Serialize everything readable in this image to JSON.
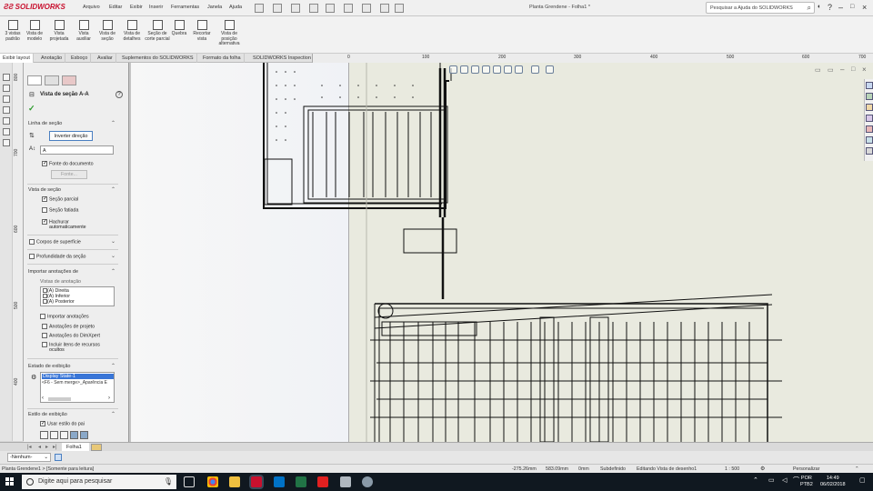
{
  "app": {
    "brand": "SOLIDWORKS",
    "doc_title": "Planta Grendene - Folha1 *",
    "menu": [
      "Arquivo",
      "Editar",
      "Exibir",
      "Inserir",
      "Ferramentas",
      "Janela",
      "Ajuda"
    ],
    "help_search_placeholder": "Pesquisar a Ajuda do SOLIDWORKS"
  },
  "ribbon": {
    "buttons": [
      {
        "label": "3 vistas padrão"
      },
      {
        "label": "Vista de modelo"
      },
      {
        "label": "Vista projetada"
      },
      {
        "label": "Vista auxiliar"
      },
      {
        "label": "Vista de seção"
      },
      {
        "label": "Vista de detalhes"
      },
      {
        "label": "Seção de corte parcial"
      },
      {
        "label": "Quebra"
      },
      {
        "label": "Recortar vista"
      },
      {
        "label": "Vista de posição alternativa"
      }
    ]
  },
  "tabs": [
    "Exibir layout",
    "Anotação",
    "Esboço",
    "Avaliar",
    "Suplementos do SOLIDWORKS",
    "Formato da folha",
    "SOLIDWORKS Inspection"
  ],
  "ruler_top": [
    "0",
    "100",
    "200",
    "300",
    "400",
    "500",
    "600",
    "700"
  ],
  "ruler_left": [
    "800",
    "700",
    "600",
    "500",
    "400"
  ],
  "property_manager": {
    "title": "Vista de seção A-A",
    "help": "?",
    "sections": {
      "linha_de_secao": {
        "header": "Linha de seção",
        "inverter_button": "Inverter direção",
        "label_value": "A",
        "fonte_documento": "Fonte do documento",
        "fonte_button": "Fonte..."
      },
      "vista_de_secao": {
        "header": "Vista de seção",
        "secao_parcial": "Seção parcial",
        "secao_fatiada": "Seção fatiada",
        "hachurar_line1": "Hachurar",
        "hachurar_line2": "automaticamente"
      },
      "corpos_de_superficie": {
        "header": "Corpos de superfície"
      },
      "profundidade": {
        "header": "Profundidade da seção"
      },
      "importar_anotacoes": {
        "header": "Importar anotações de",
        "sublabel": "Vistas de anotação",
        "list": [
          "(A) Direita",
          "(A) Inferior",
          "(A) Posterior"
        ],
        "importar": "Importar anotações",
        "projeto": "Anotações de projeto",
        "dimxpert": "Anotações do DimXpert",
        "incluir_line1": "Incluir itens de recursos",
        "incluir_line2": "ocultos"
      },
      "estado_de_exibicao": {
        "header": "Estado de exibição",
        "selected": "Display State-1",
        "sub": "<F6 - Sem merge>_Aparência E"
      },
      "estilo_de_exibicao": {
        "header": "Estilo de exibição",
        "usar_estilo_pai": "Usar estilo do pai"
      }
    }
  },
  "sheet_tab": "Folha1",
  "nenhum": "-Nenhum-",
  "status": {
    "left": "Planta Grendene1 > [Somente para leitura]",
    "x": "-275.26mm",
    "y": "583.09mm",
    "z": "0mm",
    "state": "Subdefinido",
    "editing": "Editando Vista de desenho1",
    "scale": "1 : 500",
    "units": "Personalizar"
  },
  "taskbar": {
    "search_placeholder": "Digite aqui para pesquisar",
    "lang_line1": "POR",
    "lang_line2": "PTB2",
    "time": "14:49",
    "date": "06/02/2018"
  },
  "colors": {
    "brand_red": "#c8102e",
    "selection_blue": "#3875d7",
    "sheet_bg": "#e9eadf",
    "taskbar_bg": "#101820"
  }
}
